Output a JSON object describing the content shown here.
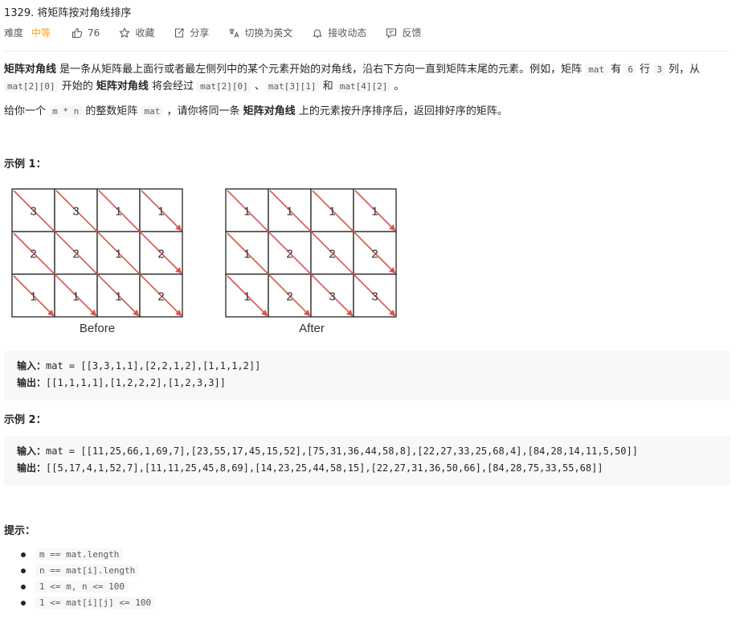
{
  "problem": {
    "title": "1329. 将矩阵按对角线排序"
  },
  "meta": {
    "difficulty_label": "难度",
    "difficulty_value": "中等",
    "likes": "76",
    "favorite": "收藏",
    "share": "分享",
    "switch_lang": "切换为英文",
    "notify": "接收动态",
    "feedback": "反馈"
  },
  "description": {
    "p1_term": "矩阵对角线",
    "p1_a": " 是一条从矩阵最上面行或者最左侧列中的某个元素开始的对角线，沿右下方向一直到矩阵末尾的元素。例如，矩阵 ",
    "p1_mat": "mat",
    "p1_b": " 有 ",
    "p1_6": "6",
    "p1_c": " 行 ",
    "p1_3": "3",
    "p1_d": " 列，从",
    "p1_code1": "mat[2][0]",
    "p1_e": " 开始的 ",
    "p1_term2": "矩阵对角线",
    "p1_f": " 将会经过 ",
    "p1_code2": "mat[2][0]",
    "p1_g": " 、",
    "p1_code3": "mat[3][1]",
    "p1_h": " 和 ",
    "p1_code4": "mat[4][2]",
    "p1_i": " 。",
    "p2_a": "给你一个 ",
    "p2_code": "m * n",
    "p2_b": " 的整数矩阵 ",
    "p2_mat": "mat",
    "p2_c": " ，请你将同一条 ",
    "p2_term": "矩阵对角线",
    "p2_d": " 上的元素按升序排序后，返回排好序的矩阵。"
  },
  "example1": {
    "heading": "示例 1：",
    "before_label": "Before",
    "after_label": "After",
    "before": [
      [
        3,
        3,
        1,
        1
      ],
      [
        2,
        2,
        1,
        2
      ],
      [
        1,
        1,
        1,
        2
      ]
    ],
    "after": [
      [
        1,
        1,
        1,
        1
      ],
      [
        1,
        2,
        2,
        2
      ],
      [
        1,
        2,
        3,
        3
      ]
    ],
    "input_label": "输入：",
    "input": "mat = [[3,3,1,1],[2,2,1,2],[1,1,1,2]]",
    "output_label": "输出：",
    "output": "[[1,1,1,1],[1,2,2,2],[1,2,3,3]]"
  },
  "example2": {
    "heading": "示例 2：",
    "input_label": "输入：",
    "input": "mat = [[11,25,66,1,69,7],[23,55,17,45,15,52],[75,31,36,44,58,8],[22,27,33,25,68,4],[84,28,14,11,5,50]]",
    "output_label": "输出：",
    "output": "[[5,17,4,1,52,7],[11,11,25,45,8,69],[14,23,25,44,58,15],[22,27,31,36,50,66],[84,28,75,33,55,68]]"
  },
  "hints": {
    "heading": "提示：",
    "items": [
      "m ==  mat.length",
      "n ==  mat[i].length",
      "1 <= m, n  <= 100",
      "1 <= mat[i][j] <= 100"
    ]
  },
  "colors": {
    "arrow": "#d9534f",
    "difficulty": "#ffa116"
  }
}
